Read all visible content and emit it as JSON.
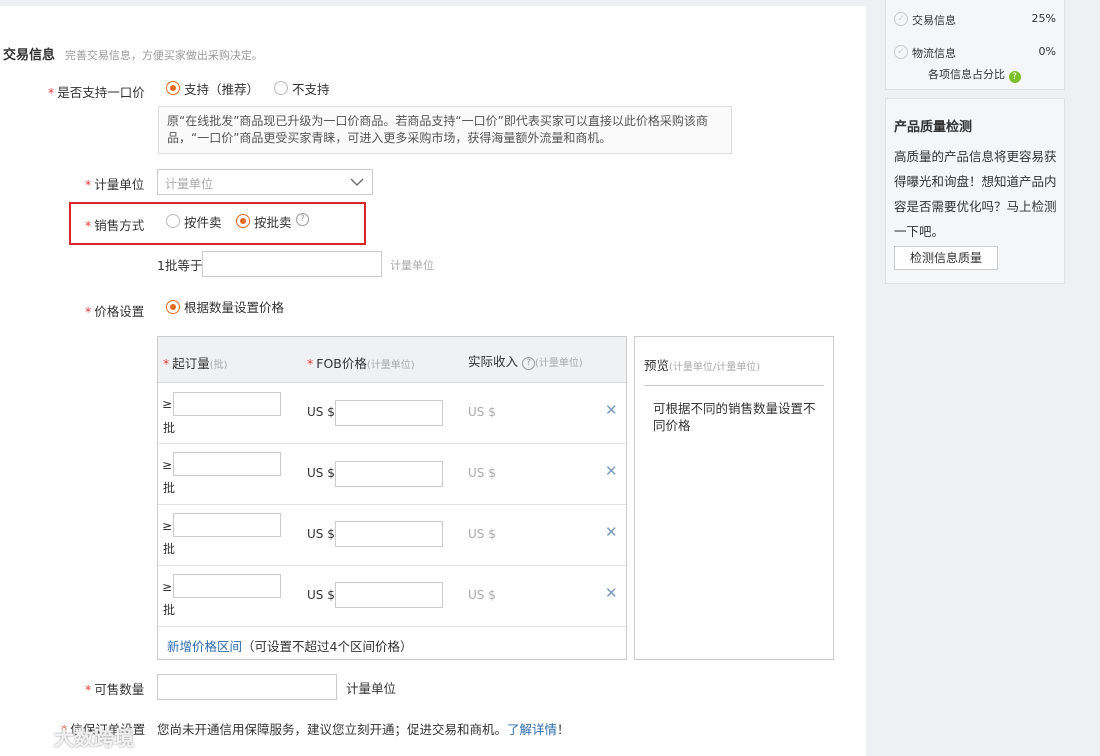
{
  "section": {
    "title": "交易信息",
    "subtitle": "完善交易信息，方便买家做出采购决定。"
  },
  "one_price": {
    "label": "是否支持一口价",
    "option_yes": "支持（推荐）",
    "option_no": "不支持",
    "selected": "yes",
    "tip": "原“在线批发”商品现已升级为一口价商品。若商品支持“一口价”即代表买家可以直接以此价格采购该商品，“一口价”商品更受买家青睐，可进入更多采购市场，获得海量额外流量和商机。"
  },
  "unit": {
    "label": "计量单位",
    "placeholder": "计量单位"
  },
  "sale_method": {
    "label": "销售方式",
    "option_piece": "按件卖",
    "option_batch": "按批卖",
    "selected": "batch",
    "highlight_color": "#d9262b"
  },
  "batch": {
    "prefix": "1批等于",
    "suffix": "计量单位"
  },
  "price": {
    "label": "价格设置",
    "option": "根据数量设置价格",
    "headers": {
      "min_order": "起订量",
      "min_order_unit": "(批)",
      "fob": "FOB价格",
      "fob_unit": "(计量单位)",
      "income": "实际收入",
      "income_unit": "(计量单位)"
    },
    "rows": [
      {
        "ge": "≥",
        "unit": "批",
        "currency": "US $",
        "income": "US $"
      },
      {
        "ge": "≥",
        "unit": "批",
        "currency": "US $",
        "income": "US $"
      },
      {
        "ge": "≥",
        "unit": "批",
        "currency": "US $",
        "income": "US $"
      },
      {
        "ge": "≥",
        "unit": "批",
        "currency": "US $",
        "income": "US $"
      }
    ],
    "add_link": "新增价格区间",
    "add_note": "（可设置不超过4个区间价格）",
    "preview_title": "预览",
    "preview_unit": "(计量单位/计量单位)",
    "preview_text": "可根据不同的销售数量设置不同价格"
  },
  "stock": {
    "label": "可售数量",
    "suffix": "计量单位"
  },
  "credit": {
    "label": "信保订单设置",
    "text": "您尚未开通信用保障服务，建议您立刻开通；促进交易和商机。",
    "link": "了解详情",
    "end": "！"
  },
  "sidebar": {
    "progress": [
      {
        "label": "交易信息",
        "percent": "25%"
      },
      {
        "label": "物流信息",
        "percent": "0%"
      }
    ],
    "ratio_label": "各项信息占分比",
    "quality_title": "产品质量检测",
    "quality_text": "高质量的产品信息将更容易获得曝光和询盘！想知道产品内容是否需要优化吗？马上检测一下吧。",
    "quality_button": "检测信息质量"
  },
  "watermark": "大数跨境",
  "colors": {
    "accent": "#e56a1f",
    "required": "#e4393c",
    "link": "#2d6dad",
    "highlight": "#d9262b"
  }
}
